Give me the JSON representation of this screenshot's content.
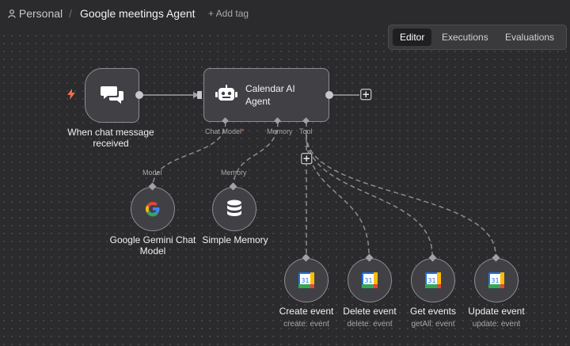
{
  "breadcrumb": {
    "workspace": "Personal",
    "separator": "/"
  },
  "workflow": {
    "title": "Google meetings Agent",
    "add_tag": "+ Add tag"
  },
  "tabs": [
    {
      "label": "Editor",
      "active": true
    },
    {
      "label": "Executions",
      "active": false
    },
    {
      "label": "Evaluations",
      "active": false
    }
  ],
  "nodes": {
    "trigger": {
      "label": "When chat message received",
      "icon": "chat-bubbles-icon"
    },
    "agent": {
      "label_line1": "Calendar AI",
      "label_line2": "Agent",
      "icon": "robot-icon",
      "ports": {
        "chat_model": "Chat Model",
        "required_mark": "*",
        "memory": "Memory",
        "tool": "Tool"
      }
    },
    "gemini": {
      "label_line1": "Google Gemini Chat",
      "label_line2": "Model",
      "port": "Model",
      "icon": "google-g-icon"
    },
    "memory": {
      "label": "Simple Memory",
      "port": "Memory",
      "icon": "database-icon"
    },
    "tools": [
      {
        "label": "Create event",
        "sub": "create: event"
      },
      {
        "label": "Delete event",
        "sub": "delete: event"
      },
      {
        "label": "Get events",
        "sub": "getAll: event"
      },
      {
        "label": "Update event",
        "sub": "update: event"
      }
    ],
    "calendar_day": "31"
  },
  "colors": {
    "canvas": "#2b2b2d",
    "node": "#414145",
    "trigger_accent": "#ef6d4a"
  }
}
